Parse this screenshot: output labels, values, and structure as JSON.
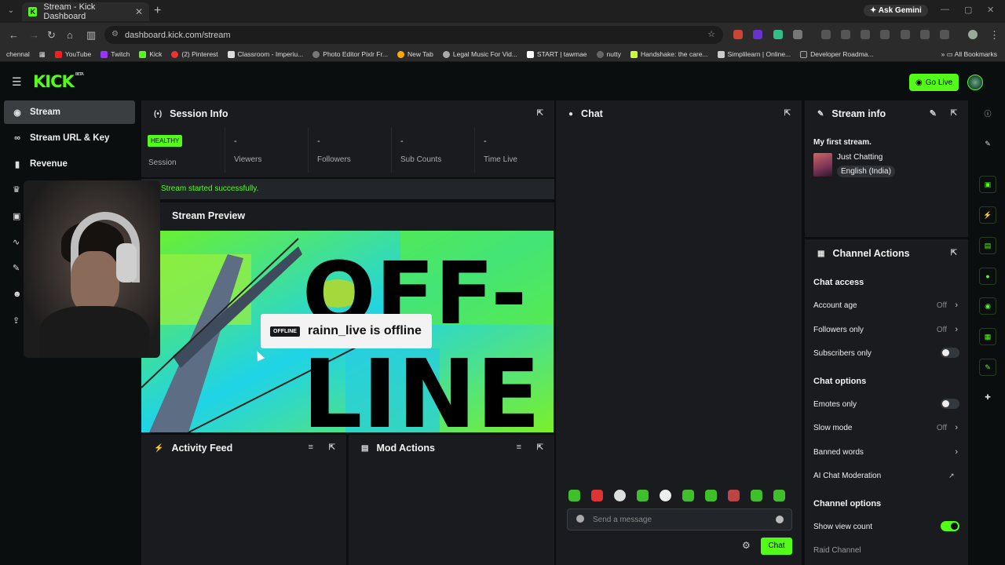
{
  "browser": {
    "tab_title": "Stream - Kick Dashboard",
    "ask_gemini": "Ask Gemini",
    "url": "dashboard.kick.com/stream",
    "bookmarks": [
      "chennal",
      "YouTube",
      "Twitch",
      "Kick",
      "(2) Pinterest",
      "Classroom - Imperiu...",
      "Photo Editor Pixlr Fr...",
      "New Tab",
      "Legal Music For Vid...",
      "START | tawmae",
      "nutty",
      "Handshake: the care...",
      "Simplilearn | Online...",
      "Developer Roadma..."
    ],
    "all_bookmarks": "All Bookmarks"
  },
  "header": {
    "logo": "KICK",
    "logo_badge": "BETA",
    "go_live": "Go Live"
  },
  "sidebar": {
    "items": [
      {
        "label": "Stream",
        "icon": "stream-icon"
      },
      {
        "label": "Stream URL & Key",
        "icon": "link-icon"
      },
      {
        "label": "Revenue",
        "icon": "revenue-icon"
      }
    ]
  },
  "session": {
    "title": "Session Info",
    "status": "HEALTHY",
    "status_label": "Session",
    "stats": [
      {
        "value": "-",
        "label": "Viewers"
      },
      {
        "value": "-",
        "label": "Followers"
      },
      {
        "value": "-",
        "label": "Sub Counts"
      },
      {
        "value": "-",
        "label": "Time Live"
      }
    ],
    "message": "Stream started successfully."
  },
  "preview": {
    "title": "Stream Preview",
    "badge": "OFFLINE",
    "offline_text": "rainn_live is offline",
    "art_text_top": "OFF-",
    "art_text_bottom": "LINE"
  },
  "activity": {
    "title": "Activity Feed"
  },
  "mod": {
    "title": "Mod Actions"
  },
  "chat": {
    "title": "Chat",
    "placeholder": "Send a message",
    "button": "Chat"
  },
  "stream_info": {
    "title": "Stream info",
    "stream_title": "My first stream.",
    "category": "Just Chatting",
    "language": "English (India)"
  },
  "channel_actions": {
    "title": "Channel Actions",
    "chat_access": "Chat access",
    "account_age": {
      "label": "Account age",
      "value": "Off"
    },
    "followers_only": {
      "label": "Followers only",
      "value": "Off"
    },
    "subscribers_only": {
      "label": "Subscribers only",
      "on": false
    },
    "chat_options": "Chat options",
    "emotes_only": {
      "label": "Emotes only",
      "on": false
    },
    "slow_mode": {
      "label": "Slow mode",
      "value": "Off"
    },
    "banned_words": {
      "label": "Banned words"
    },
    "ai_moderation": {
      "label": "AI Chat Moderation"
    },
    "channel_options": "Channel options",
    "show_view_count": {
      "label": "Show view count",
      "on": true
    },
    "raid_channel": {
      "label": "Raid Channel"
    }
  },
  "colors": {
    "accent": "#53fc18",
    "panel": "#191b1f",
    "background": "#0b0e0f"
  }
}
